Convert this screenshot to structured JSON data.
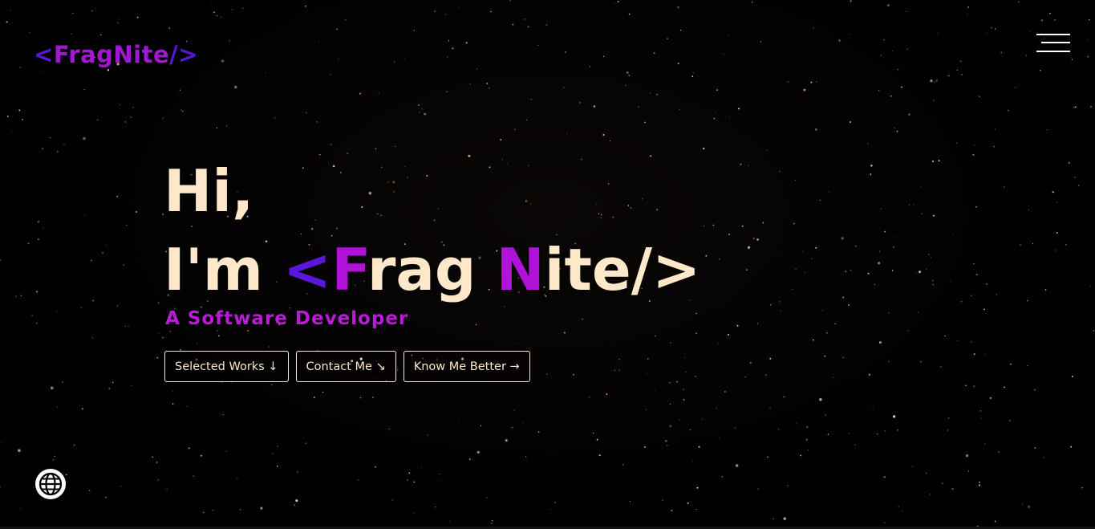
{
  "header": {
    "logo_open": "<",
    "logo_name": "FragNite",
    "logo_close": "/>",
    "menu_icon": "hamburger-icon"
  },
  "hero": {
    "greeting": "Hi,",
    "intro_prefix": "I'm ",
    "name_open": "<",
    "name_first_cap": "F",
    "name_first_rest": "rag ",
    "name_second_cap": "N",
    "name_second_rest": "ite",
    "name_close": "/>",
    "subtitle": "A Software Developer"
  },
  "buttons": {
    "selected_works": "Selected Works ↓",
    "contact_me": "Contact Me ↘",
    "know_me_better": "Know Me Better →"
  },
  "footer": {
    "language_icon": "globe-icon"
  },
  "colors": {
    "background": "#000000",
    "cream": "#fde8c9",
    "purple": "#b112d8",
    "indigo": "#5b17d9"
  }
}
